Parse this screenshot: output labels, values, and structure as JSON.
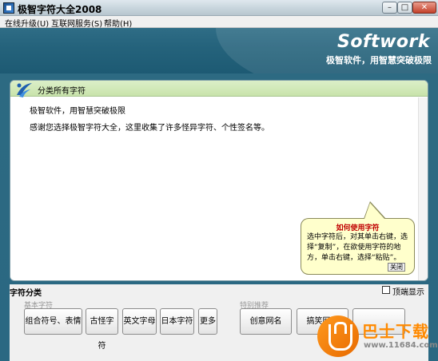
{
  "window": {
    "title": "极智字符大全2008",
    "minimize_glyph": "–",
    "maximize_glyph": "□",
    "close_glyph": "✕"
  },
  "menubar": {
    "items": [
      {
        "label": "在线升级(U)"
      },
      {
        "label": "互联网服务(S)"
      },
      {
        "label": "帮助(H)"
      }
    ]
  },
  "banner": {
    "brand": "Softwork",
    "slogan": "极智软件，用智慧突破极限"
  },
  "panel": {
    "title": "分类所有字符",
    "lines": [
      "极智软件，用智慧突破极限",
      "感谢您选择极智字符大全，这里收集了许多怪异字符、个性签名等。"
    ]
  },
  "help_bubble": {
    "title": "如何使用字符",
    "text": "选中字符后，对其单击右键，选择“复制”，在欲使用字符的地方，单击右键，选择“粘贴”。",
    "close_label": "关闭"
  },
  "categories": {
    "title": "字符分类",
    "topmost_label": "顶端显示",
    "topmost_checked": false,
    "basic_group_label": "基本字符",
    "special_group_label": "特别推荐",
    "basic_buttons": [
      "组合符号、表情",
      "古怪字符",
      "英文字母",
      "日本字符",
      "更多"
    ],
    "special_buttons": [
      "创意网名",
      "搞笑网名",
      ""
    ]
  },
  "watermark": {
    "text": "巴士下载",
    "url": "www.11684.com"
  },
  "colors": {
    "banner": "#25637c",
    "panel_header": "#c8e3ab",
    "bubble_bg": "#ffffcc",
    "bubble_title": "#c00000",
    "watermark_orange": "#ff8a00"
  }
}
